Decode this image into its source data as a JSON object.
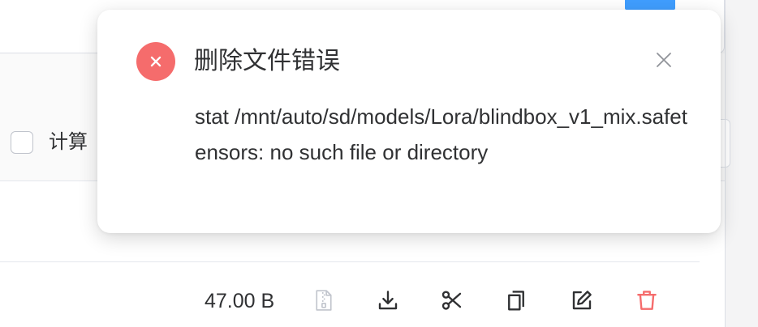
{
  "colors": {
    "error": "#f56c6c",
    "accent": "#409eff",
    "text": "#303133",
    "muted_icon": "#c0c4cc",
    "danger_icon": "#f56c6c"
  },
  "toolbar": {
    "checkbox_label": "计算"
  },
  "file_row": {
    "size": "47.00 B",
    "actions": [
      {
        "icon": "file-zip-icon",
        "label": ""
      },
      {
        "icon": "download-icon",
        "label": ""
      },
      {
        "icon": "scissors-icon",
        "label": ""
      },
      {
        "icon": "copy-icon",
        "label": ""
      },
      {
        "icon": "edit-icon",
        "label": ""
      },
      {
        "icon": "trash-icon",
        "label": ""
      }
    ]
  },
  "notification": {
    "type": "error",
    "icon": "error-circle-icon",
    "title": "删除文件错误",
    "message": "stat /mnt/auto/sd/models/Lora/blindbox_v1_mix.safetensors: no such file or directory",
    "close_icon": "close-icon"
  }
}
